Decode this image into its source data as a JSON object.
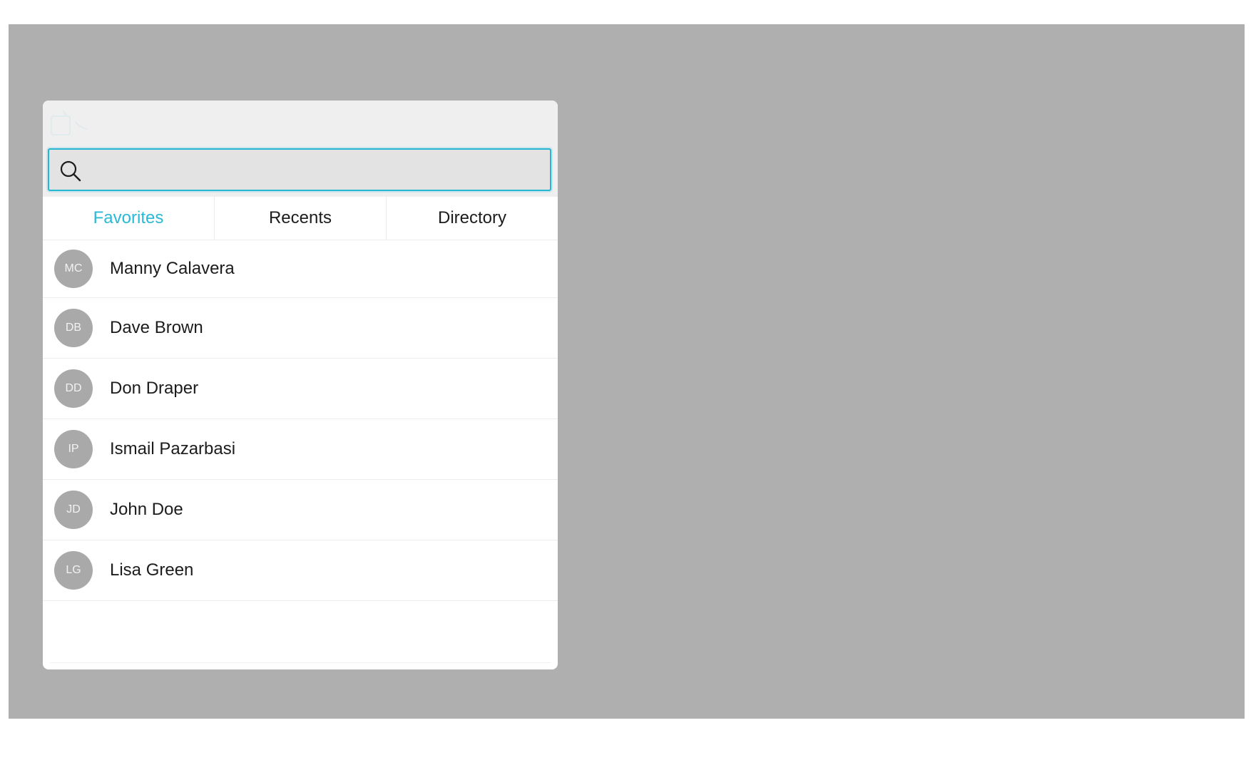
{
  "search": {
    "value": "",
    "placeholder": ""
  },
  "tabs": [
    {
      "label": "Favorites",
      "active": true
    },
    {
      "label": "Recents",
      "active": false
    },
    {
      "label": "Directory",
      "active": false
    }
  ],
  "contacts": [
    {
      "initials": "MC",
      "name": "Manny Calavera"
    },
    {
      "initials": "DB",
      "name": "Dave Brown"
    },
    {
      "initials": "DD",
      "name": "Don Draper"
    },
    {
      "initials": "IP",
      "name": "Ismail Pazarbasi"
    },
    {
      "initials": "JD",
      "name": "John Doe"
    },
    {
      "initials": "LG",
      "name": "Lisa Green"
    }
  ],
  "colors": {
    "accent": "#2ab9d6",
    "backdrop": "#afafaf",
    "avatar": "#a9a9a9"
  },
  "icons": {
    "header": "call-icon",
    "search": "search-icon"
  }
}
